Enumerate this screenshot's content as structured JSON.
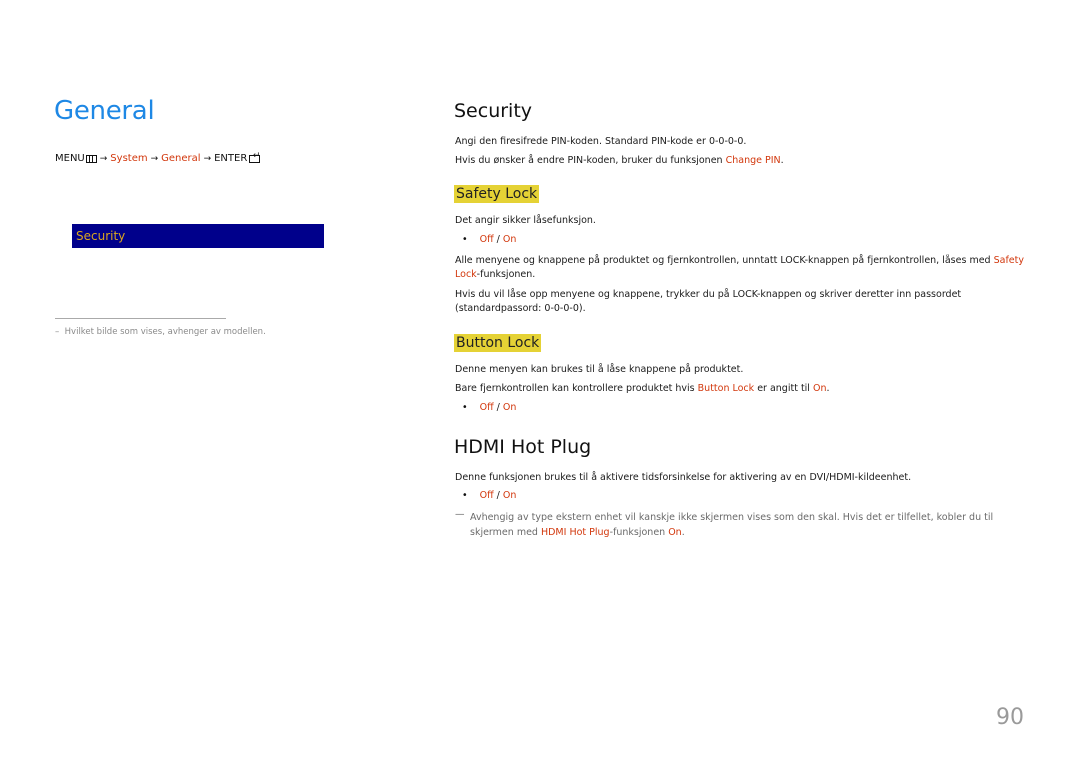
{
  "left": {
    "title": "General",
    "breadcrumb": {
      "menu": "MENU",
      "menu_icon": "menu-icon",
      "items": [
        "System",
        "General"
      ],
      "enter": "ENTER",
      "enter_icon": "enter-icon"
    },
    "menu_highlight": "Security",
    "footnote": "Hvilket bilde som vises, avhenger av modellen.",
    "footnote_dash": "–"
  },
  "security": {
    "heading": "Security",
    "p1": "Angi den firesifrede PIN-koden. Standard PIN-kode er 0-0-0-0.",
    "p2_prefix": "Hvis du ønsker å endre PIN-koden, bruker du funksjonen ",
    "p2_link": "Change PIN",
    "p2_suffix": "."
  },
  "safety_lock": {
    "heading": "Safety Lock",
    "desc": "Det angir sikker låsefunksjon.",
    "options": {
      "off": "Off",
      "sep": " / ",
      "on": "On"
    },
    "p1_a": "Alle menyene og knappene på produktet og fjernkontrollen, unntatt LOCK-knappen på fjernkontrollen, låses med ",
    "p1_link": "Safety Lock",
    "p1_b": "-funksjonen.",
    "p2": "Hvis du vil låse opp menyene og knappene, trykker du på LOCK-knappen og skriver deretter inn passordet (standardpassord: 0-0-0-0)."
  },
  "button_lock": {
    "heading": "Button Lock",
    "p1": "Denne menyen kan brukes til å låse knappene på produktet.",
    "p2_a": "Bare fjernkontrollen kan kontrollere produktet hvis ",
    "p2_link": "Button Lock",
    "p2_b": " er angitt til ",
    "p2_on": "On",
    "p2_c": ".",
    "options": {
      "off": "Off",
      "sep": " / ",
      "on": "On"
    }
  },
  "hdmi_hot_plug": {
    "heading": "HDMI Hot Plug",
    "p1": "Denne funksjonen brukes til å aktivere tidsforsinkelse for aktivering av en DVI/HDMI-kildeenhet.",
    "options": {
      "off": "Off",
      "sep": " / ",
      "on": "On"
    },
    "note_dash": "—",
    "note_a": "Avhengig av type ekstern enhet vil kanskje ikke skjermen vises som den skal. Hvis det er tilfellet, kobler du til skjermen med ",
    "note_link": "HDMI Hot Plug",
    "note_b": "-funksjonen ",
    "note_on": "On",
    "note_c": "."
  },
  "page_number": "90",
  "colors": {
    "title_blue": "#1e88e5",
    "accent_red": "#d2370c",
    "highlight_yellow": "#e5d235",
    "menu_box_navy": "#00008b",
    "menu_box_text": "#d9a520"
  }
}
